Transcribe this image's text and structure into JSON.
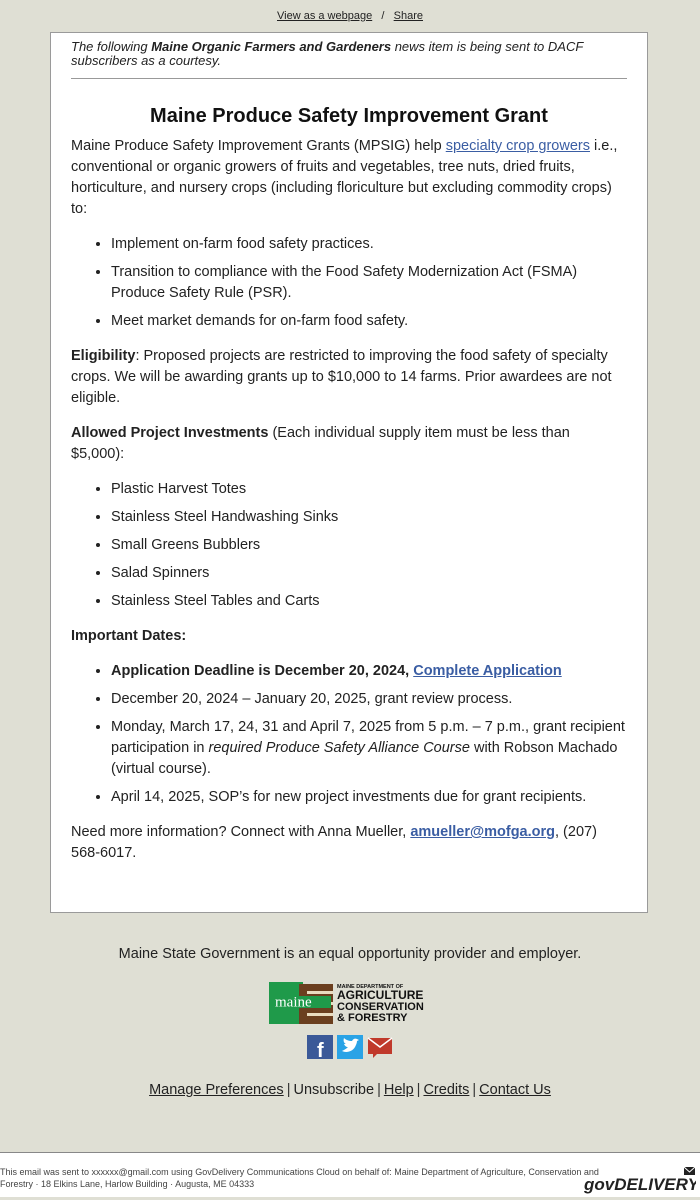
{
  "topbar": {
    "view_webpage": "View as a webpage",
    "separator": "/",
    "share": "Share"
  },
  "courtesy": {
    "before": "The following ",
    "org": "Maine Organic Farmers and Gardeners",
    "after": " news item is being sent to DACF subscribers as a courtesy."
  },
  "article": {
    "title": "Maine Produce Safety Improvement Grant",
    "intro_before": "Maine Produce Safety Improvement Grants (MPSIG) help ",
    "intro_link": "specialty crop growers",
    "intro_after": " i.e., conventional or organic growers of fruits and vegetables, tree nuts, dried fruits, horticulture, and nursery crops (including floriculture but excluding commodity crops) to:",
    "goals": [
      "Implement on-farm food safety practices.",
      "Transition to compliance with the Food Safety Modernization Act (FSMA) Produce Safety Rule (PSR).",
      "Meet market demands for on-farm food safety."
    ],
    "eligibility_label": "Eligibility",
    "eligibility_text": ": Proposed projects are restricted to improving the food safety of specialty crops. We will be awarding grants up to $10,000 to 14 farms. Prior awardees are not eligible.",
    "investments_label": "Allowed Project Investments",
    "investments_text": " (Each individual supply item must be less than $5,000):",
    "investments": [
      "Plastic Harvest Totes",
      "Stainless Steel Handwashing Sinks",
      "Small Greens Bubblers",
      "Salad Spinners",
      "Stainless Steel Tables and Carts"
    ],
    "dates_label": "Important Dates:",
    "dates": {
      "deadline_text": "Application Deadline is December 20, 2024, ",
      "deadline_link": "Complete Application",
      "review": "December 20, 2024 – January 20, 2025, grant review process.",
      "course_before": "Monday, March 17, 24, 31 and April 7, 2025 from 5 p.m. – 7 p.m., grant recipient participation in ",
      "course_italic": "required Produce Safety Alliance Course",
      "course_after": " with Robson Machado (virtual course).",
      "sop": "April 14, 2025, SOP’s for new project investments due for grant recipients."
    },
    "contact_before": "Need more information? Connect with Anna Mueller, ",
    "contact_email": "amueller@mofga.org",
    "contact_after": ", (207) 568-6017."
  },
  "footer": {
    "equal_opportunity": "Maine State Government is an equal opportunity provider and employer.",
    "logo": {
      "maine_word": "maine",
      "line1": "MAINE DEPARTMENT OF",
      "line2": "AGRICULTURE",
      "line3": "CONSERVATION",
      "line4": "& FORESTRY"
    },
    "social_icons": [
      "facebook-icon",
      "twitter-icon",
      "email-icon"
    ],
    "links": [
      "Manage Preferences",
      "Unsubscribe",
      "Help",
      "Credits",
      "Contact Us"
    ],
    "sent_notice": "This email was sent to xxxxxx@gmail.com using GovDelivery Communications Cloud on behalf of: Maine Department of Agriculture, Conservation and Forestry · 18 Elkins Lane, Harlow Building · Augusta, ME 04333",
    "brand": "govDELIVERY"
  },
  "colors": {
    "background": "#dfdfd4",
    "link": "#3a5da3",
    "logo_green": "#1f9a4a",
    "logo_brown": "#6b3f1f",
    "facebook": "#3b5998",
    "twitter": "#2aa3e6",
    "email_red": "#c0392b"
  }
}
